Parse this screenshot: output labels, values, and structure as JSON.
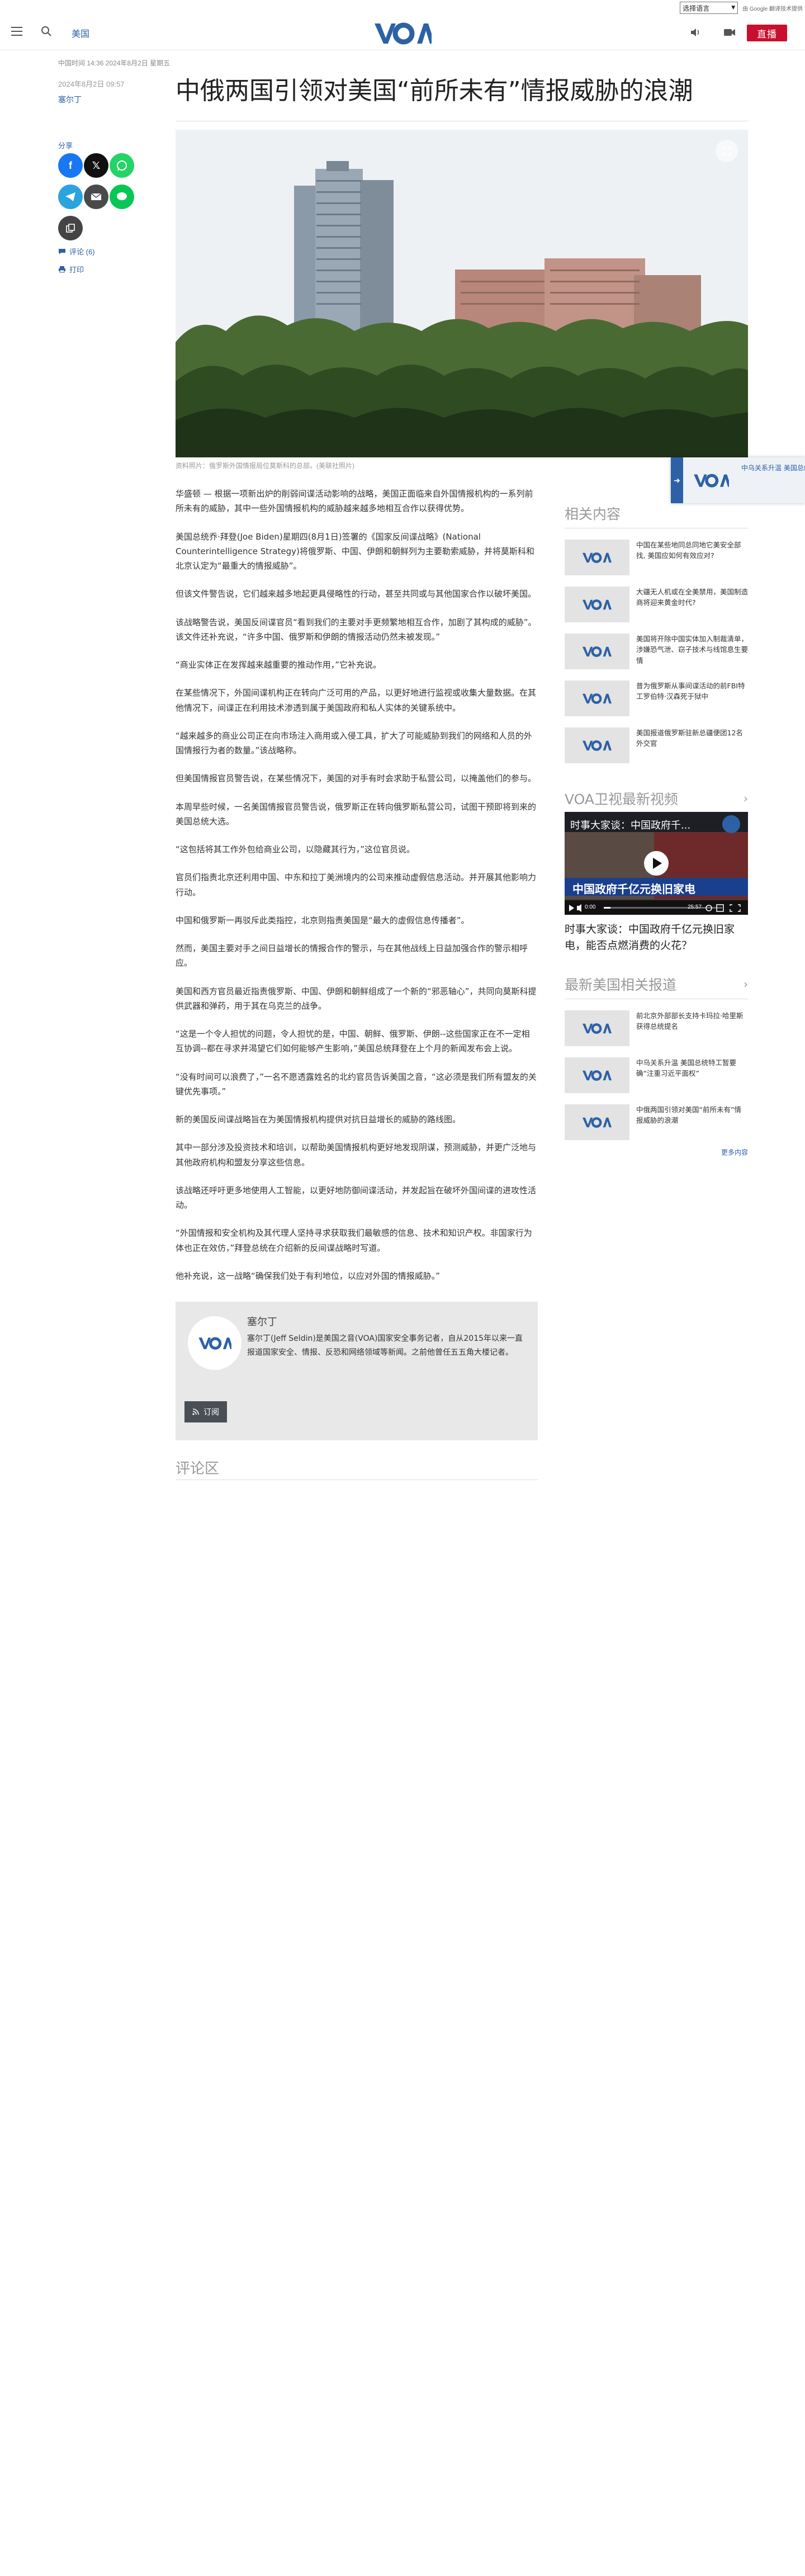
{
  "translate": {
    "select_label": "选择语言",
    "powered_by": "由 Google 翻译技术提供"
  },
  "header": {
    "section": "美国",
    "logo_text": "VOA",
    "live_label": "直播"
  },
  "breadcrumb": "中国时间 14:36 2024年8月2日 星期五",
  "article": {
    "date": "2024年8月2日 09:57",
    "author": "塞尔丁",
    "title": "中俄两国引领对美国“前所未有”情报威胁的浪潮",
    "image_caption": "资料照片：俄罗斯外国情报局位莫斯科的总部。(美联社照片)",
    "paragraphs": [
      "华盛顿 — 根据一项新出炉的削弱间谍活动影响的战略，美国正面临来自外国情报机构的一系列前所未有的威胁，其中一些外国情报机构的威胁越来越多地相互合作以获得优势。",
      "美国总统乔·拜登(Joe Biden)星期四(8月1日)签署的《国家反间谍战略》(National Counterintelligence Strategy)将俄罗斯、中国、伊朗和朝鲜列为主要勒索威胁，并将莫斯科和北京认定为“最重大的情报威胁”。",
      "但该文件警告说，它们越来越多地起更具侵略性的行动，甚至共同或与其他国家合作以破坏美国。",
      "该战略警告说，美国反间谍官员“看到我们的主要对手更频繁地相互合作，加剧了其构成的威胁”。该文件还补充说，“许多中国、俄罗斯和伊朗的情报活动仍然未被发现。”",
      "“商业实体正在发挥越来越重要的推动作用，”它补充说。",
      "在某些情况下，外国间谍机构正在转向广泛可用的产品，以更好地进行监视或收集大量数据。在其他情况下，间谍正在利用技术渗透到属于美国政府和私人实体的关键系统中。",
      "“越来越多的商业公司正在向市场注入商用或入侵工具，扩大了可能威胁到我们的网络和人员的外国情报行为者的数量。”该战略称。",
      "但美国情报官员警告说，在某些情况下，美国的对手有时会求助于私营公司，以掩盖他们的参与。",
      "本周早些时候，一名美国情报官员警告说，俄罗斯正在转向俄罗斯私营公司，试图干预即将到来的美国总统大选。",
      "“这包括将其工作外包给商业公司，以隐藏其行为，”这位官员说。",
      "官员们指责北京还利用中国、中东和拉丁美洲境内的公司来推动虚假信息活动。并开展其他影响力行动。",
      "中国和俄罗斯一再驳斥此类指控，北京则指责美国是“最大的虚假信息传播者”。",
      "然而，美国主要对手之间日益增长的情报合作的警示，与在其他战线上日益加强合作的警示相呼应。",
      "美国和西方官员最近指责俄罗斯、中国、伊朗和朝鲜组成了一个新的“邪恶轴心”，共同向莫斯科提供武器和弹药，用于其在乌克兰的战争。",
      "“这是一个令人担忧的问题，令人担忧的是，中国、朝鲜、俄罗斯、伊朗--这些国家正在不一定相互协调--都在寻求并渴望它们如何能够产生影响，”美国总统拜登在上个月的新闻发布会上说。",
      "“没有时间可以浪费了，”一名不愿透露姓名的北约官员告诉美国之音，“这必须是我们所有盟友的关键优先事项。”",
      "新的美国反间谍战略旨在为美国情报机构提供对抗日益增长的威胁的路线图。",
      "其中一部分涉及投资技术和培训，以帮助美国情报机构更好地发现阴谋，预测威胁，并更广泛地与其他政府机构和盟友分享这些信息。",
      "该战略还呼吁更多地使用人工智能，以更好地防御间谍活动，并发起旨在破坏外国间谍的进攻性活动。",
      "“外国情报和安全机构及其代理人坚持寻求获取我们最敏感的信息、技术和知识产权。非国家行为体也正在效仿，”拜登总统在介绍新的反间谍战略时写道。",
      "他补充说，这一战略“确保我们处于有利地位，以应对外国的情报威胁。”"
    ]
  },
  "share": {
    "label": "分享",
    "comments": "评论 (6)",
    "print": "打印"
  },
  "author_box": {
    "name": "塞尔丁",
    "bio": "塞尔丁(Jeff Seldin)是美国之音(VOA)国家安全事务记者，自从2015年以来一直报道国家安全、情报、反恐和网络领域等新闻。之前他曾任五五角大楼记者。",
    "subscribe": "订阅"
  },
  "comments_heading": "评论区",
  "rail": {
    "related_title": "相关内容",
    "related": [
      "中国在某些地同总同地它美安全部找, 美国应如何有效应对?",
      "大疆无人机或在全美禁用，美国制造商将迎来黄金时代?",
      "美国将开除中国实体加入制裁清单，涉嫌恐气泄、窃子技术与线馆息生要情",
      "普为俄罗斯从事间谍活动的前FBI特工罗伯特·汉森死于狱中",
      "美国报道俄罗斯驻新总疆便团12名外交官"
    ],
    "video_section_title": "VOA卫视最新视频",
    "video": {
      "overlay_title": "时事大家谈：中国政府千...",
      "banner": "中国政府千亿元换旧家电",
      "time_current": "0:00",
      "time_total": "25:57",
      "title": "时事大家谈：中国政府千亿元换旧家电，能否点燃消费的火花？"
    },
    "latest_title": "最新美国相关报道",
    "latest": [
      "前北京外部部长支持卡玛拉·哈里斯获得总统提名",
      "中乌关系升温 美国总统特工暂要确“注重习近平面权”",
      "中俄两国引领对美国“前所未有”情报威胁的浪潮"
    ],
    "more": "更多内容"
  },
  "promo": {
    "text": "中乌关系升温 美国总统特工暂要确“注重习近平面权”"
  }
}
